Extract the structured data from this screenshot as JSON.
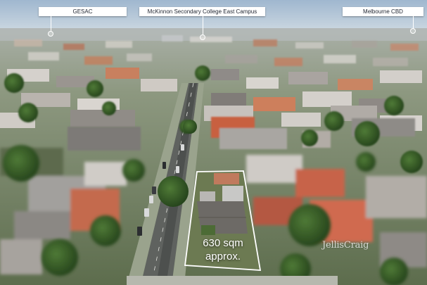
{
  "labels": {
    "gesac": "GESAC",
    "mckinnon": "McKinnon Secondary College East Campus",
    "cbd": "Melbourne CBD"
  },
  "lot": {
    "area_line1": "630 sqm",
    "area_line2": "approx."
  },
  "watermark": "JellisCraig"
}
